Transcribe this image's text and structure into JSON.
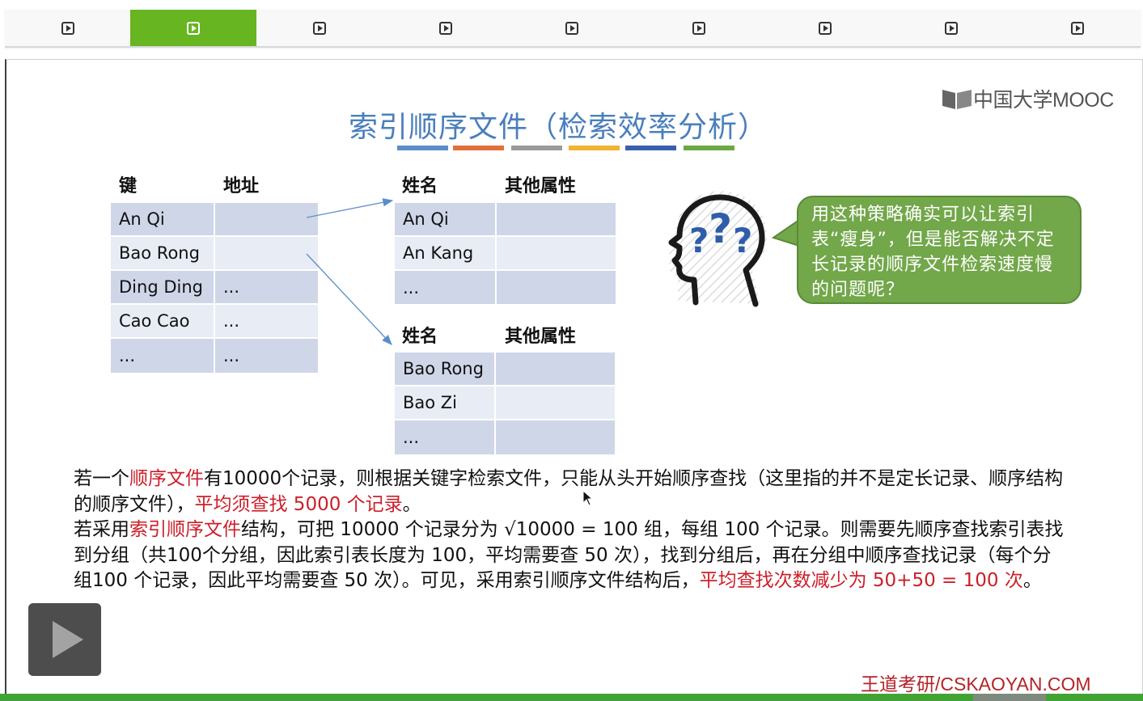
{
  "player": {
    "segments": 9,
    "active_segment": 2
  },
  "slide": {
    "logo_text": "中国大学MOOC",
    "title": "索引顺序文件（检索效率分析）",
    "underline_colors": [
      "#5b8ec9",
      "#e0703b",
      "#9a9a9a",
      "#f2b233",
      "#3a5fad",
      "#6ca843"
    ],
    "index_table": {
      "headers": [
        "键",
        "地址"
      ],
      "rows": [
        [
          "An Qi",
          ""
        ],
        [
          "Bao Rong",
          ""
        ],
        [
          "Ding Ding",
          "..."
        ],
        [
          "Cao Cao",
          "..."
        ],
        [
          "...",
          "..."
        ]
      ]
    },
    "group1": {
      "headers": [
        "姓名",
        "其他属性"
      ],
      "rows": [
        [
          "An Qi",
          ""
        ],
        [
          "An Kang",
          ""
        ],
        [
          "...",
          ""
        ]
      ]
    },
    "group2": {
      "headers": [
        "姓名",
        "其他属性"
      ],
      "rows": [
        [
          "Bao Rong",
          ""
        ],
        [
          "Bao Zi",
          ""
        ],
        [
          "...",
          ""
        ]
      ]
    },
    "bubble_text": "用这种策略确实可以让索引表“瘦身”，但是能否解决不定长记录的顺序文件检索速度慢的问题呢？",
    "paragraph": {
      "p1_a": "若一个",
      "p1_b": "顺序文件",
      "p1_c": "有10000个记录，则根据关键字检索文件，只能从头开始顺序查找（这里指的并不是定长记录、顺序结构 的顺序文件），",
      "p1_d": "平均须查找 5000 个记录",
      "p1_e": "。",
      "p2_a": "若采用",
      "p2_b": "索引顺序文件",
      "p2_c": "结构，可把 10000 个记录分为 √10000 = 100  组，每组 100 个记录。则需要先顺序查找索引表找到分组（共100个分组，因此索引表长度为 100，平均需要查 50 次），找到分组后，再在分组中顺序查找记录（每个分组100 个记录，因此平均需要查 50 次）。可见，采用索引顺序文件结构后，",
      "p2_d": "平均查找次数减少为 50+50 = 100 次",
      "p2_e": "。"
    },
    "footer": "王道考研/CSKAOYAN.COM"
  }
}
